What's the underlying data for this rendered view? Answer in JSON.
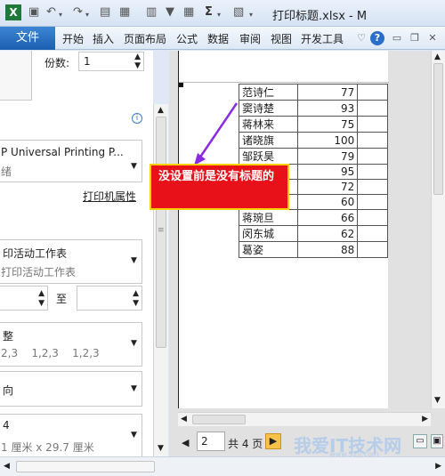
{
  "window": {
    "title": "打印标题.xlsx - M"
  },
  "quick_access": {
    "icons": [
      "excel-logo-icon",
      "save-icon",
      "undo-icon",
      "redo-icon",
      "print-preview-icon",
      "format-icon",
      "calc-icon",
      "filter-icon",
      "autosum-icon",
      "format-painter-icon",
      "customize-icon"
    ],
    "sigma_glyph": "Σ"
  },
  "ribbon": {
    "file_tab": "文件",
    "tabs": [
      "开始",
      "插入",
      "页面布局",
      "公式",
      "数据",
      "审阅",
      "视图",
      "开发工具"
    ],
    "help_glyph": "?"
  },
  "print_settings": {
    "copies_label": "份数:",
    "copies_value": "1",
    "info_glyph": "i",
    "printer_name": "P Universal Printing P...",
    "printer_status": "绪",
    "printer_properties_link": "打印机属性",
    "scope_main": "印活动工作表",
    "scope_sub": "打印活动工作表",
    "pages_to_label": "至",
    "collate_main": "整",
    "collate_sub": "2,3    1,2,3    1,2,3",
    "orientation_main": "向",
    "paper_main": "4",
    "paper_sub": "1 厘米 x 29.7 厘米"
  },
  "preview": {
    "rows": [
      {
        "name": "范诗仁",
        "score": "77"
      },
      {
        "name": "窦诗楚",
        "score": "93"
      },
      {
        "name": "蒋林来",
        "score": "75"
      },
      {
        "name": "诸晓旗",
        "score": "100"
      },
      {
        "name": "邹跃昊",
        "score": "79"
      },
      {
        "name": "",
        "score": "95"
      },
      {
        "name": "",
        "score": "72"
      },
      {
        "name": "",
        "score": "60"
      },
      {
        "name": "蒋琬旦",
        "score": "66"
      },
      {
        "name": "闵东城",
        "score": "62"
      },
      {
        "name": "葛姿",
        "score": "88"
      }
    ]
  },
  "callout": {
    "text": "没设置前是没有标题的",
    "background": "#e8111a",
    "border": "#f7d000"
  },
  "navigation": {
    "current_page": "2",
    "total_pages_text": "共 4 页"
  },
  "watermark": {
    "text": "我爱IT技术网",
    "url": "www.52ij.com"
  }
}
